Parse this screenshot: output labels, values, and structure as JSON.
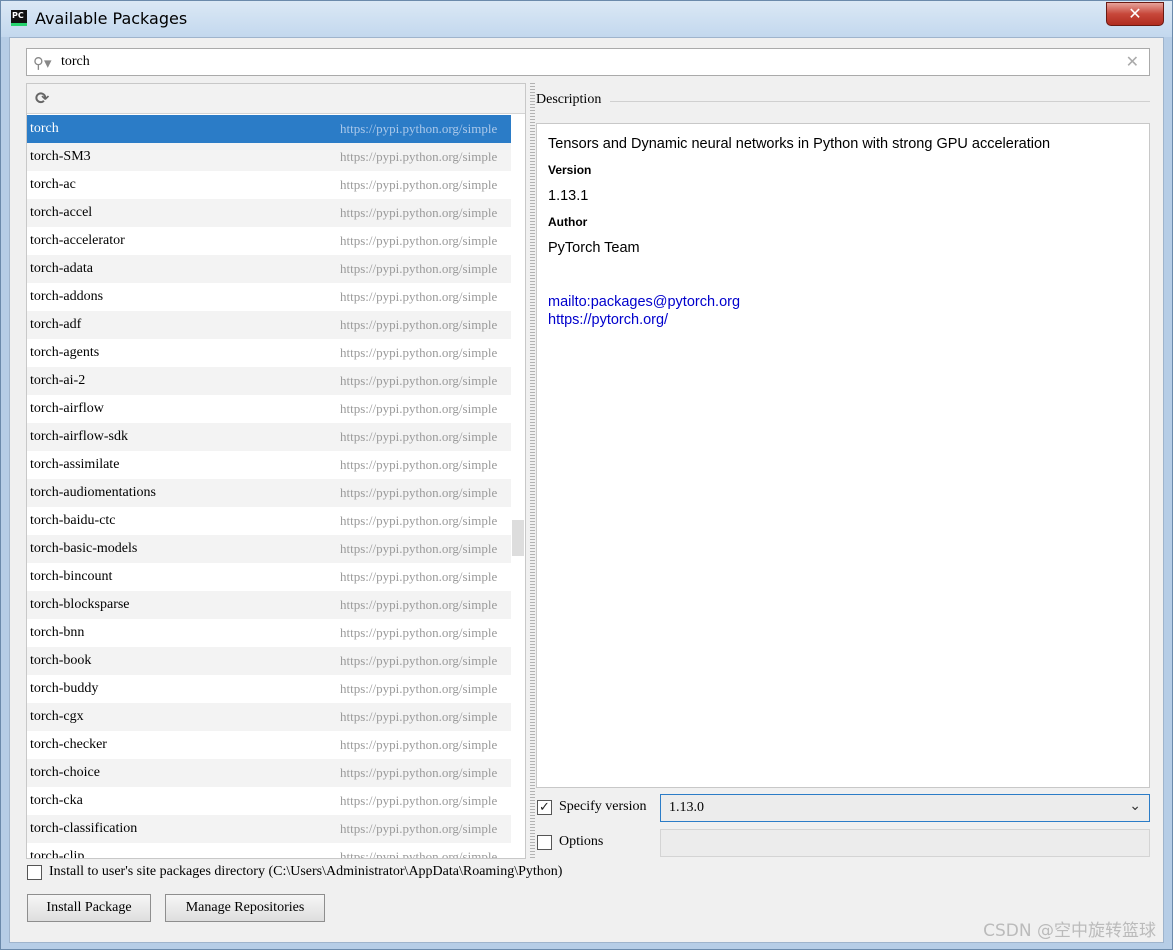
{
  "window": {
    "title": "Available Packages",
    "app_icon": "PC",
    "close_label": "✕"
  },
  "search": {
    "value": "torch",
    "icon": "search-icon",
    "clear_icon": "close-icon"
  },
  "packages": [
    {
      "name": "torch",
      "repo": "https://pypi.python.org/simple",
      "selected": true
    },
    {
      "name": "torch-SM3",
      "repo": "https://pypi.python.org/simple"
    },
    {
      "name": "torch-ac",
      "repo": "https://pypi.python.org/simple"
    },
    {
      "name": "torch-accel",
      "repo": "https://pypi.python.org/simple"
    },
    {
      "name": "torch-accelerator",
      "repo": "https://pypi.python.org/simple"
    },
    {
      "name": "torch-adata",
      "repo": "https://pypi.python.org/simple"
    },
    {
      "name": "torch-addons",
      "repo": "https://pypi.python.org/simple"
    },
    {
      "name": "torch-adf",
      "repo": "https://pypi.python.org/simple"
    },
    {
      "name": "torch-agents",
      "repo": "https://pypi.python.org/simple"
    },
    {
      "name": "torch-ai-2",
      "repo": "https://pypi.python.org/simple"
    },
    {
      "name": "torch-airflow",
      "repo": "https://pypi.python.org/simple"
    },
    {
      "name": "torch-airflow-sdk",
      "repo": "https://pypi.python.org/simple"
    },
    {
      "name": "torch-assimilate",
      "repo": "https://pypi.python.org/simple"
    },
    {
      "name": "torch-audiomentations",
      "repo": "https://pypi.python.org/simple"
    },
    {
      "name": "torch-baidu-ctc",
      "repo": "https://pypi.python.org/simple"
    },
    {
      "name": "torch-basic-models",
      "repo": "https://pypi.python.org/simple"
    },
    {
      "name": "torch-bincount",
      "repo": "https://pypi.python.org/simple"
    },
    {
      "name": "torch-blocksparse",
      "repo": "https://pypi.python.org/simple"
    },
    {
      "name": "torch-bnn",
      "repo": "https://pypi.python.org/simple"
    },
    {
      "name": "torch-book",
      "repo": "https://pypi.python.org/simple"
    },
    {
      "name": "torch-buddy",
      "repo": "https://pypi.python.org/simple"
    },
    {
      "name": "torch-cgx",
      "repo": "https://pypi.python.org/simple"
    },
    {
      "name": "torch-checker",
      "repo": "https://pypi.python.org/simple"
    },
    {
      "name": "torch-choice",
      "repo": "https://pypi.python.org/simple"
    },
    {
      "name": "torch-cka",
      "repo": "https://pypi.python.org/simple"
    },
    {
      "name": "torch-classification",
      "repo": "https://pypi.python.org/simple"
    },
    {
      "name": "torch-clip",
      "repo": "https://pypi.python.org/simple"
    }
  ],
  "description": {
    "header": "Description",
    "summary": "Tensors and Dynamic neural networks in Python with strong GPU acceleration",
    "version_label": "Version",
    "version_value": "1.13.1",
    "author_label": "Author",
    "author_value": "PyTorch Team",
    "email_link": "mailto:packages@pytorch.org",
    "home_link": "https://pytorch.org/"
  },
  "specify_version": {
    "checked": true,
    "label": "Specify version",
    "value": "1.13.0"
  },
  "options": {
    "checked": false,
    "label": "Options",
    "value": ""
  },
  "install_user": {
    "checked": false,
    "label": "Install to user's site packages directory (C:\\Users\\Administrator\\AppData\\Roaming\\Python)"
  },
  "buttons": {
    "install": "Install Package",
    "manage": "Manage Repositories"
  },
  "watermark": "CSDN @空中旋转篮球"
}
